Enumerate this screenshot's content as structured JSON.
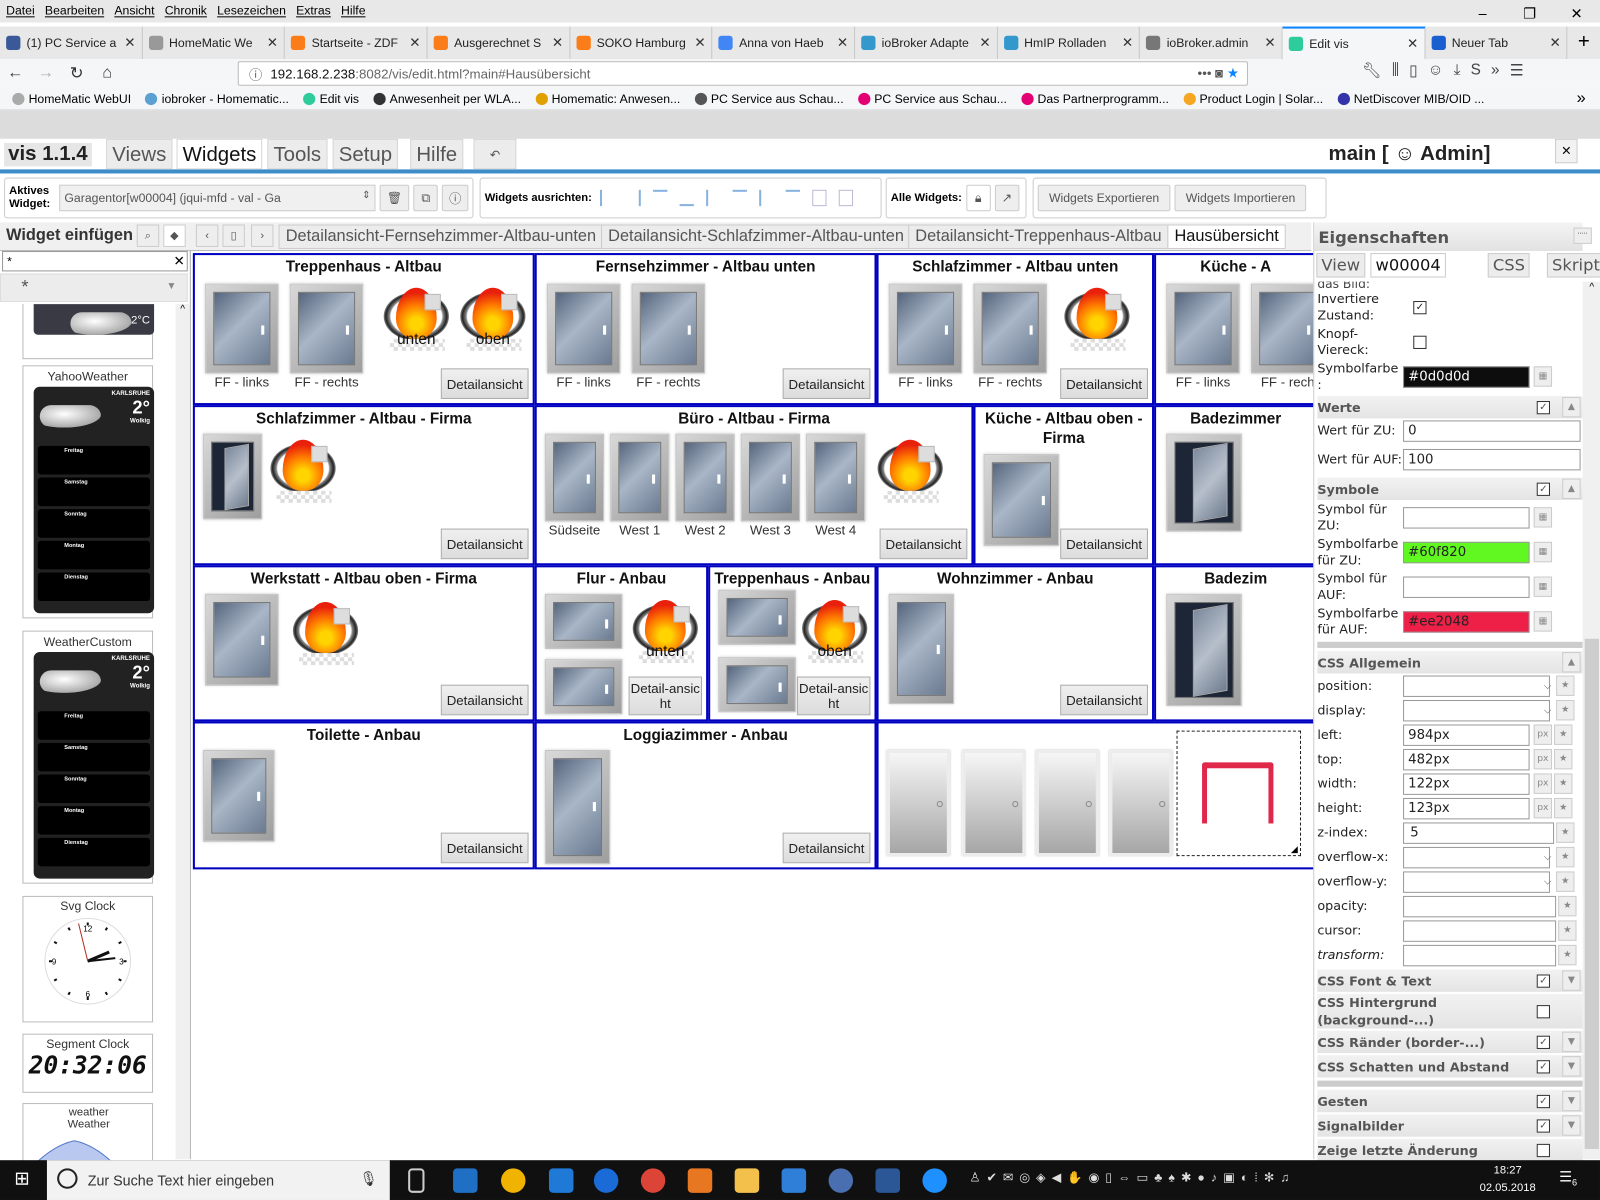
{
  "browser": {
    "menu": [
      "Datei",
      "Bearbeiten",
      "Ansicht",
      "Chronik",
      "Lesezeichen",
      "Extras",
      "Hilfe"
    ],
    "tabs": [
      {
        "label": "(1) PC Service a",
        "color": "#3b5998"
      },
      {
        "label": "HomeMatic We",
        "color": "#999999"
      },
      {
        "label": "Startseite - ZDF",
        "color": "#fa7d19"
      },
      {
        "label": "Ausgerechnet S",
        "color": "#fa7d19"
      },
      {
        "label": "SOKO Hamburg",
        "color": "#fa7d19"
      },
      {
        "label": "Anna von Haeb",
        "color": "#4285f4"
      },
      {
        "label": "ioBroker Adapte",
        "color": "#3399cc"
      },
      {
        "label": "HmIP Rolladen",
        "color": "#3399cc"
      },
      {
        "label": "ioBroker.admin",
        "color": "#777777"
      },
      {
        "label": "Edit vis",
        "color": "#2ecc9a",
        "active": true
      },
      {
        "label": "Neuer Tab",
        "color": "#1a5fd0"
      }
    ],
    "url_host": "192.168.2.238",
    "url_rest": ":8082/vis/edit.html?main#Hausübersicht",
    "bookmarks": [
      {
        "label": "HomeMatic WebUI",
        "color": "#aaaaaa"
      },
      {
        "label": "iobroker - Homematic...",
        "color": "#5aa0d0"
      },
      {
        "label": "Edit vis",
        "color": "#2ecc9a"
      },
      {
        "label": "Anwesenheit per WLA...",
        "color": "#333333"
      },
      {
        "label": "Homematic: Anwesen...",
        "color": "#e0a000"
      },
      {
        "label": "PC Service aus Schau...",
        "color": "#555555"
      },
      {
        "label": "PC Service aus Schau...",
        "color": "#e20074"
      },
      {
        "label": "Das Partnerprogramm...",
        "color": "#e20074"
      },
      {
        "label": "Product Login | Solar...",
        "color": "#f5a623"
      },
      {
        "label": "NetDiscover MIB/OID ...",
        "color": "#3333aa"
      }
    ]
  },
  "vis": {
    "version": "vis 1.1.4",
    "tabs": [
      {
        "label": "Views"
      },
      {
        "label": "Widgets",
        "active": true
      },
      {
        "label": "Tools"
      },
      {
        "label": "Setup"
      },
      {
        "label": "Hilfe"
      }
    ],
    "undo_icon": "↶",
    "title": "main [ ☺ Admin]"
  },
  "toolbar": {
    "active_widget_label": "Aktives Widget:",
    "active_widget_value": "Garagentor[w00004] (jqui-mfd - val - Ga",
    "align_label": "Widgets ausrichten:",
    "all_widgets_label": "Alle Widgets:",
    "export_label": "Widgets Exportieren",
    "import_label": "Widgets Importieren"
  },
  "insert": {
    "title": "Widget einfügen",
    "filter_value": "*",
    "category": "*",
    "widgets": [
      "YahooWeather",
      "WeatherCustom",
      "Svg Clock",
      "Segment Clock",
      "weather Weather"
    ],
    "weather": {
      "city": "KARLSRUHE",
      "temp": "2°",
      "condition": "Wolkig",
      "preview_temp": "2°C",
      "days": [
        "Freitag",
        "Samstag",
        "Sonntag",
        "Montag",
        "Dienstag"
      ]
    },
    "clock_numbers": [
      "12",
      "3",
      "6",
      "9"
    ],
    "segment_time": "20:32:06"
  },
  "views": [
    {
      "label": "Detailansicht-Fernsehzimmer-Altbau-unten"
    },
    {
      "label": "Detailansicht-Schlafzimmer-Altbau-unten"
    },
    {
      "label": "Detailansicht-Treppenhaus-Altbau"
    },
    {
      "label": "Hausübersicht",
      "active": true
    }
  ],
  "rooms": [
    {
      "title": "Treppenhaus - Altbau",
      "button": "Detailansicht",
      "items": [
        {
          "type": "window",
          "label": "FF - links"
        },
        {
          "type": "window",
          "label": "FF - rechts"
        },
        {
          "type": "fire",
          "label": "unten"
        },
        {
          "type": "fire",
          "label": "oben"
        }
      ]
    },
    {
      "title": "Fernsehzimmer - Altbau unten",
      "button": "Detailansicht",
      "items": [
        {
          "type": "window",
          "label": "FF - links"
        },
        {
          "type": "window",
          "label": "FF - rechts"
        }
      ]
    },
    {
      "title": "Schlafzimmer - Altbau unten",
      "button": "Detailansicht",
      "items": [
        {
          "type": "window",
          "label": "FF - links"
        },
        {
          "type": "window",
          "label": "FF - rechts"
        },
        {
          "type": "fire",
          "label": ""
        }
      ]
    },
    {
      "title": "Küche - A",
      "items": [
        {
          "type": "window",
          "label": "FF - links"
        },
        {
          "type": "window",
          "label": "FF - rech"
        }
      ]
    },
    {
      "title": "Schlafzimmer - Altbau - Firma",
      "button": "Detailansicht",
      "items": [
        {
          "type": "window-open",
          "label": ""
        },
        {
          "type": "fire",
          "label": ""
        }
      ]
    },
    {
      "title": "Büro - Altbau - Firma",
      "button": "Detailansicht",
      "items": [
        {
          "type": "window",
          "label": "Südseite"
        },
        {
          "type": "window",
          "label": "West 1"
        },
        {
          "type": "window",
          "label": "West 2"
        },
        {
          "type": "window",
          "label": "West 3"
        },
        {
          "type": "window",
          "label": "West 4"
        },
        {
          "type": "fire",
          "label": ""
        }
      ]
    },
    {
      "title": "Küche - Altbau oben - Firma",
      "button": "Detailansicht",
      "items": [
        {
          "type": "window",
          "label": ""
        }
      ]
    },
    {
      "title": "Badezimmer",
      "items": [
        {
          "type": "window-open",
          "label": ""
        }
      ]
    },
    {
      "title": "Werkstatt - Altbau oben - Firma",
      "button": "Detailansicht",
      "items": [
        {
          "type": "window",
          "label": ""
        },
        {
          "type": "fire",
          "label": ""
        }
      ]
    },
    {
      "title": "Flur - Anbau",
      "button": "Detail-ansicht",
      "items": [
        {
          "type": "window",
          "label": ""
        },
        {
          "type": "window",
          "label": ""
        },
        {
          "type": "fire",
          "label": "unten"
        }
      ]
    },
    {
      "title": "Treppenhaus - Anbau",
      "button": "Detail-ansicht",
      "items": [
        {
          "type": "window",
          "label": ""
        },
        {
          "type": "window",
          "label": ""
        },
        {
          "type": "fire",
          "label": "oben"
        }
      ]
    },
    {
      "title": "Wohnzimmer - Anbau",
      "button": "Detailansicht",
      "items": [
        {
          "type": "window",
          "label": ""
        }
      ]
    },
    {
      "title": "Badezim",
      "items": [
        {
          "type": "window-open",
          "label": ""
        }
      ]
    },
    {
      "title": "Toilette - Anbau",
      "button": "Detailansicht",
      "items": [
        {
          "type": "window",
          "label": ""
        }
      ]
    },
    {
      "title": "Loggiazimmer - Anbau",
      "button": "Detailansicht",
      "items": [
        {
          "type": "window",
          "label": ""
        }
      ]
    },
    {
      "title": "",
      "items": [
        {
          "type": "door",
          "label": ""
        },
        {
          "type": "door",
          "label": ""
        },
        {
          "type": "door",
          "label": ""
        },
        {
          "type": "door",
          "label": ""
        },
        {
          "type": "table",
          "label": ""
        }
      ]
    }
  ],
  "properties": {
    "title": "Eigenschaften",
    "tabs": [
      {
        "label": "View"
      },
      {
        "label": "w00004",
        "active": true
      },
      {
        "label": "CSS"
      },
      {
        "label": "Skripte"
      }
    ],
    "cut_label": "das Bild:",
    "top_rows": [
      {
        "label": "Invertiere Zustand:",
        "type": "checkbox",
        "checked": true
      },
      {
        "label": "Knopf-Viereck:",
        "type": "checkbox",
        "checked": false
      },
      {
        "label": "Symbolfarbe :",
        "type": "color",
        "value": "#0d0d0d",
        "color": "#0d0d0d",
        "text": "#ffffff"
      }
    ],
    "groups": [
      {
        "title": "Werte",
        "checked": true,
        "expanded": true,
        "rows": [
          {
            "label": "Wert für ZU:",
            "type": "text",
            "value": "0"
          },
          {
            "label": "Wert für AUF:",
            "type": "text",
            "value": "100"
          }
        ]
      },
      {
        "title": "Symbole",
        "checked": true,
        "expanded": true,
        "rows": [
          {
            "label": "Symbol für ZU:",
            "type": "icon",
            "value": ""
          },
          {
            "label": "Symbolfarbe für ZU:",
            "type": "color",
            "value": "#60f820",
            "color": "#60f820",
            "text": "#222222"
          },
          {
            "label": "Symbol für AUF:",
            "type": "icon",
            "value": ""
          },
          {
            "label": "Symbolfarbe für AUF:",
            "type": "color",
            "value": "#ee2048",
            "color": "#ee2048",
            "text": "#222222"
          }
        ]
      },
      {
        "title": "CSS Allgemein",
        "sep": true,
        "expanded": true,
        "rows": [
          {
            "label": "position:",
            "type": "select",
            "value": ""
          },
          {
            "label": "display:",
            "type": "select",
            "value": ""
          },
          {
            "label": "left:",
            "type": "px",
            "value": "984px"
          },
          {
            "label": "top:",
            "type": "px",
            "value": "482px"
          },
          {
            "label": "width:",
            "type": "px",
            "value": "122px"
          },
          {
            "label": "height:",
            "type": "px",
            "value": "123px"
          },
          {
            "label": "z-index:",
            "type": "spin",
            "value": "5"
          },
          {
            "label": "overflow-x:",
            "type": "select",
            "value": ""
          },
          {
            "label": "overflow-y:",
            "type": "select",
            "value": ""
          },
          {
            "label": "opacity:",
            "type": "wide",
            "value": ""
          },
          {
            "label": "cursor:",
            "type": "wide",
            "value": ""
          },
          {
            "label": "transform:",
            "type": "wide",
            "value": "",
            "italic": true
          }
        ]
      },
      {
        "title": "CSS Font & Text",
        "checked": true
      },
      {
        "title": "CSS Hintergrund (background-...)",
        "checked": false,
        "nobtn": true
      },
      {
        "title": "CSS Ränder (border-...)",
        "checked": true
      },
      {
        "title": "CSS Schatten und Abstand",
        "checked": true
      },
      {
        "title": "Gesten",
        "checked": true,
        "sep": true
      },
      {
        "title": "Signalbilder",
        "checked": true
      },
      {
        "title": "Zeige letzte Änderung",
        "checked": false,
        "nobtn": true
      }
    ],
    "px_label": "px"
  },
  "taskbar": {
    "search_placeholder": "Zur Suche Text hier eingeben",
    "time": "18:27",
    "date": "02.05.2018",
    "notifications": "6"
  },
  "colors": {
    "accent": "#3c8dca",
    "room_border": "#0000c0",
    "table": "#e0284a"
  }
}
